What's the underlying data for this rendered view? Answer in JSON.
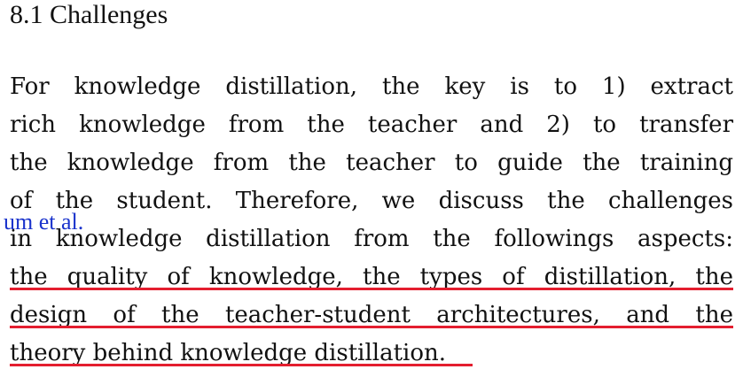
{
  "section": {
    "heading": "8.1 Challenges"
  },
  "paragraph": {
    "lines": [
      "For knowledge distillation, the key is to 1) extract",
      "rich knowledge from the teacher and 2) to transfer",
      "the knowledge from the teacher to guide the training",
      "of the student. Therefore, we discuss the challenges",
      "in knowledge distillation from the followings aspects:",
      "the quality of knowledge, the types of distillation, the",
      "design of the teacher-student architectures, and the",
      "theory behind knowledge distillation."
    ]
  },
  "citation_overlay": "um et al.",
  "colors": {
    "underline": "#e41e2f",
    "citation": "#1a33cc",
    "text": "#111111"
  }
}
